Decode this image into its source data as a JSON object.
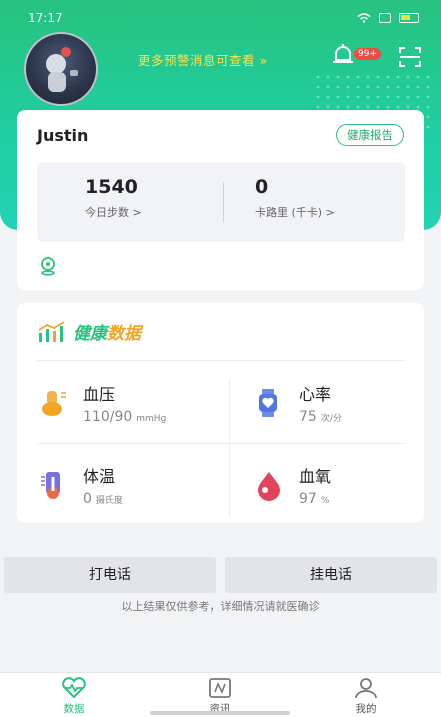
{
  "status_bar": {
    "time": "17:17"
  },
  "header": {
    "alert_link": "更多预警消息可查看 »",
    "badge": "99+"
  },
  "profile": {
    "name": "Justin",
    "report_button": "健康报告",
    "steps": {
      "value": "1540",
      "label": "今日步数 >"
    },
    "calories": {
      "value": "0",
      "label": "卡路里 (千卡) >"
    }
  },
  "health": {
    "title_part1": "健康",
    "title_part2": "数据",
    "blood_pressure": {
      "name": "血压",
      "value": "110/90",
      "unit": "mmHg"
    },
    "heart_rate": {
      "name": "心率",
      "value": "75",
      "unit": "次/分"
    },
    "temperature": {
      "name": "体温",
      "value": "0",
      "unit": "摄氏度"
    },
    "blood_oxygen": {
      "name": "血氧",
      "value": "97",
      "unit": "%"
    }
  },
  "actions": {
    "call": "打电话",
    "hangup": "挂电话",
    "disclaimer": "以上结果仅供参考，详细情况请就医确诊"
  },
  "tabs": [
    {
      "label": "数据",
      "icon": "heart-pulse-icon",
      "active": true
    },
    {
      "label": "资讯",
      "icon": "news-icon",
      "active": false
    },
    {
      "label": "我的",
      "icon": "profile-icon",
      "active": false
    }
  ],
  "colors": {
    "primary": "#27c27f",
    "accent_yellow": "#f0a623",
    "badge": "#f04b45"
  }
}
